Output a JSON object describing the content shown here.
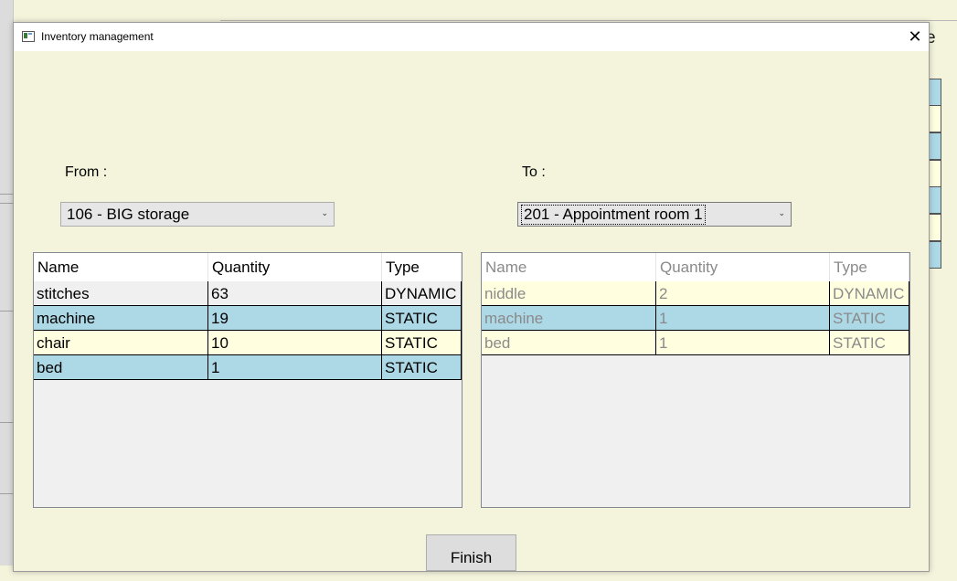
{
  "window": {
    "title": "Inventory management"
  },
  "background": {
    "partial_letter": "e"
  },
  "from": {
    "label": "From :",
    "selected": "106 - BIG storage",
    "columns": [
      "Name",
      "Quantity",
      "Type"
    ],
    "rows": [
      {
        "name": "stitches",
        "quantity": "63",
        "type": "DYNAMIC",
        "color": "#f0f0f0"
      },
      {
        "name": "machine",
        "quantity": "19",
        "type": "STATIC",
        "color": "#add8e6"
      },
      {
        "name": "chair",
        "quantity": "10",
        "type": "STATIC",
        "color": "#ffffe0"
      },
      {
        "name": "bed",
        "quantity": "1",
        "type": "STATIC",
        "color": "#add8e6"
      }
    ]
  },
  "to": {
    "label": "To :",
    "selected": "201 - Appointment room 1",
    "columns": [
      "Name",
      "Quantity",
      "Type"
    ],
    "rows": [
      {
        "name": "niddle",
        "quantity": "2",
        "type": "DYNAMIC",
        "color": "#ffffe0"
      },
      {
        "name": "machine",
        "quantity": "1",
        "type": "STATIC",
        "color": "#add8e6"
      },
      {
        "name": "bed",
        "quantity": "1",
        "type": "STATIC",
        "color": "#ffffe0"
      }
    ]
  },
  "actions": {
    "finish_label": "Finish"
  },
  "colors": {
    "background": "#f4f4dc",
    "row_blue": "#add8e6",
    "row_yellow": "#ffffe0"
  }
}
